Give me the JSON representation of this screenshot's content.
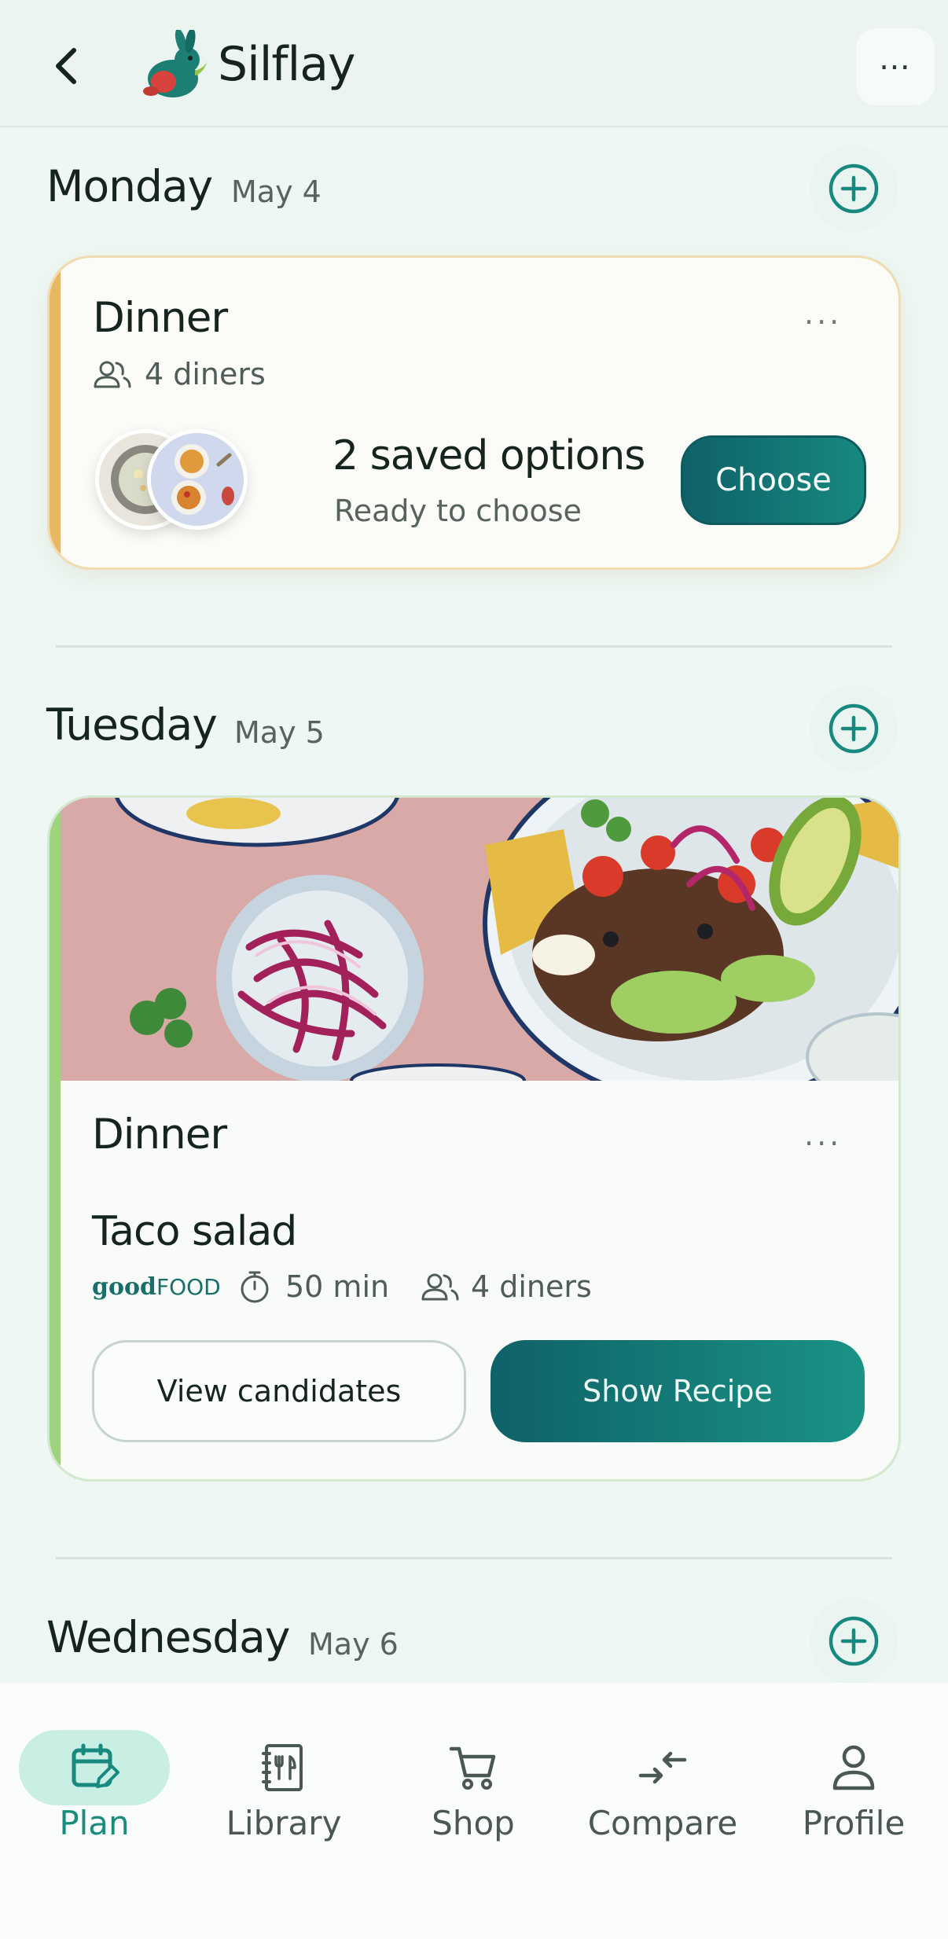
{
  "header": {
    "title": "Silflay",
    "more_label": "⋯"
  },
  "days": [
    {
      "name": "Monday",
      "date": "May 4",
      "meal": {
        "title": "Dinner",
        "diners": "4 diners",
        "options_title": "2 saved options",
        "options_sub": "Ready to choose",
        "choose_label": "Choose"
      }
    },
    {
      "name": "Tuesday",
      "date": "May 5",
      "meal": {
        "title": "Dinner",
        "recipe": "Taco salad",
        "source_bold": "good",
        "source_light": "FOOD",
        "time": "50 min",
        "diners": "4 diners",
        "view_candidates_label": "View candidates",
        "show_recipe_label": "Show Recipe"
      }
    },
    {
      "name": "Wednesday",
      "date": "May 6"
    }
  ],
  "card_more": "···",
  "nav": [
    {
      "label": "Plan",
      "icon": "calendar-edit-icon",
      "active": true
    },
    {
      "label": "Library",
      "icon": "cookbook-icon",
      "active": false
    },
    {
      "label": "Shop",
      "icon": "cart-icon",
      "active": false
    },
    {
      "label": "Compare",
      "icon": "compare-arrows-icon",
      "active": false
    },
    {
      "label": "Profile",
      "icon": "person-icon",
      "active": false
    }
  ],
  "colors": {
    "accent": "#17897f",
    "background": "#eef7f3",
    "monday_accent": "#e7b863",
    "tuesday_accent": "#9fd27d"
  }
}
